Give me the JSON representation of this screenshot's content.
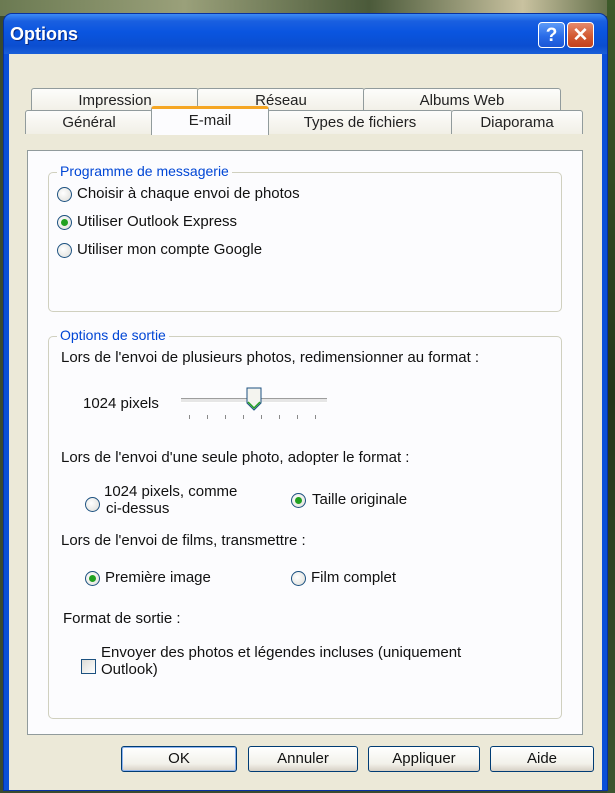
{
  "window": {
    "title": "Options",
    "help_icon": "?",
    "close_icon": "✕"
  },
  "tabs": {
    "row1": [
      "Impression",
      "Réseau",
      "Albums Web"
    ],
    "row2": [
      "Général",
      "E-mail",
      "Types de fichiers",
      "Diaporama"
    ],
    "active": "E-mail"
  },
  "programme": {
    "label": "Programme de messagerie",
    "options": [
      "Choisir à chaque envoi de photos",
      "Utiliser Outlook Express",
      "Utiliser mon compte Google"
    ],
    "selected": "Utiliser Outlook Express"
  },
  "sortie": {
    "label": "Options de sortie",
    "multi_label": "Lors de l'envoi de plusieurs photos, redimensionner au format :",
    "slider_value_label": "1024 pixels",
    "slider_position": 0.5,
    "single_label": "Lors de l'envoi d'une seule photo, adopter le format :",
    "single_opt1_line1": "1024 pixels, comme",
    "single_opt1_line2": "ci-dessus",
    "single_opt2": "Taille originale",
    "single_selected": "Taille originale",
    "films_label": "Lors de l'envoi de films, transmettre :",
    "films_opt1": "Première image",
    "films_opt2": "Film complet",
    "films_selected": "Première image",
    "format_label": "Format de sortie :",
    "format_check_line1": "Envoyer des photos et légendes incluses (uniquement",
    "format_check_line2": "Outlook)",
    "format_checked": false
  },
  "buttons": {
    "ok": "OK",
    "cancel": "Annuler",
    "apply": "Appliquer",
    "help": "Aide"
  }
}
